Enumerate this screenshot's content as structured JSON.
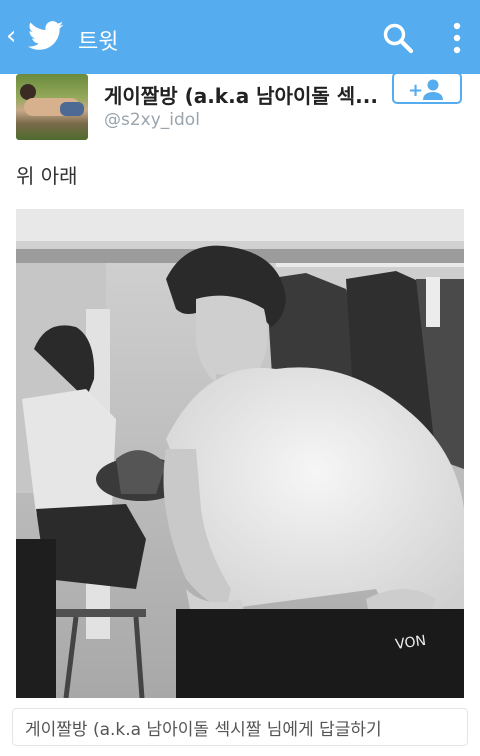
{
  "topbar": {
    "title": "트윗",
    "back_icon": "chevron-left-icon",
    "logo_icon": "twitter-bird-icon",
    "search_icon": "search-icon",
    "more_icon": "more-vertical-icon",
    "color": "#55acee"
  },
  "tweet": {
    "display_name": "게이짤방 (a.k.a 남아이돌 섹...",
    "handle": "@s2xy_idol",
    "follow_icon": "add-user-icon",
    "text": "위 아래",
    "media": "animated-gif"
  },
  "reply": {
    "prefix": "게이짤방 (a.k.a ",
    "suffix": "남아이돌 섹시짤 님에게 답글하기"
  }
}
